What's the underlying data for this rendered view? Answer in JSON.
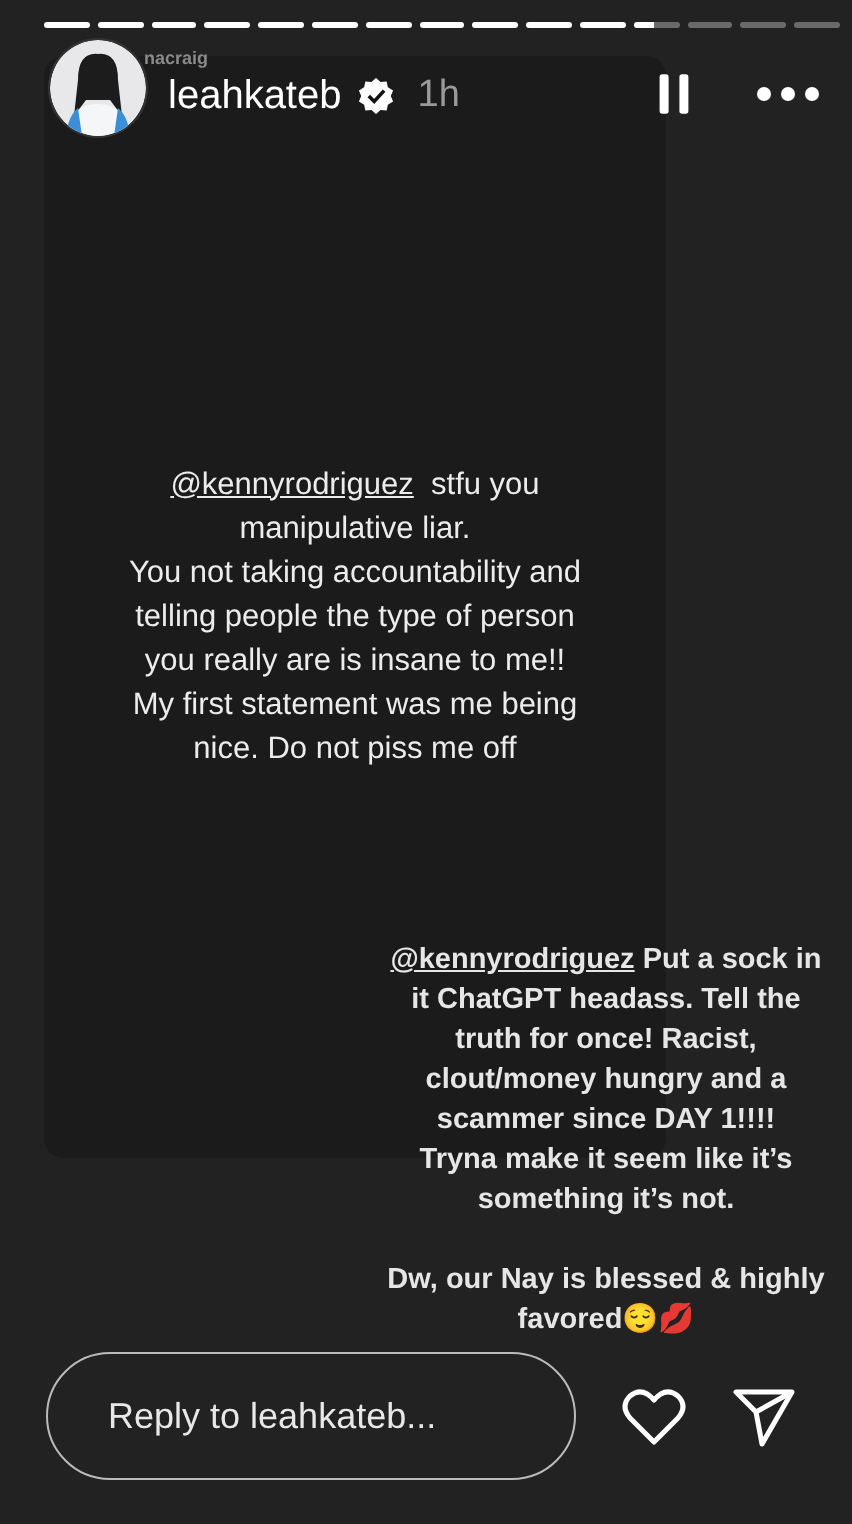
{
  "progress": [
    {
      "kind": "seen"
    },
    {
      "kind": "seen"
    },
    {
      "kind": "seen"
    },
    {
      "kind": "seen"
    },
    {
      "kind": "seen"
    },
    {
      "kind": "seen"
    },
    {
      "kind": "seen"
    },
    {
      "kind": "seen"
    },
    {
      "kind": "seen"
    },
    {
      "kind": "seen"
    },
    {
      "kind": "seen"
    },
    {
      "kind": "current",
      "level": 0.45
    },
    {
      "kind": "unseen"
    },
    {
      "kind": "unseen"
    },
    {
      "kind": "unseen"
    }
  ],
  "header": {
    "username": "leahkateb",
    "verified": true,
    "time": "1h",
    "paused": true,
    "background_tag": "nacraig"
  },
  "screenshot_card": {
    "mention": "@kennyrodriguez",
    "text": "stfu you manipulative liar.\nYou not taking accountability and telling people the type of person you really are is insane to me!!\nMy first statement was me being nice. Do not piss me off"
  },
  "caption": {
    "mention": "@kennyrodriguez",
    "text": "Put a sock in it ChatGPT headass. Tell the truth for once! Racist, clout/money hungry and a scammer since DAY 1!!!!",
    "line2": "Tryna make it seem like it’s something it’s not.",
    "line3": "Dw, our Nay is blessed & highly favored😌💋"
  },
  "reply": {
    "placeholder": "Reply to leahkateb..."
  }
}
